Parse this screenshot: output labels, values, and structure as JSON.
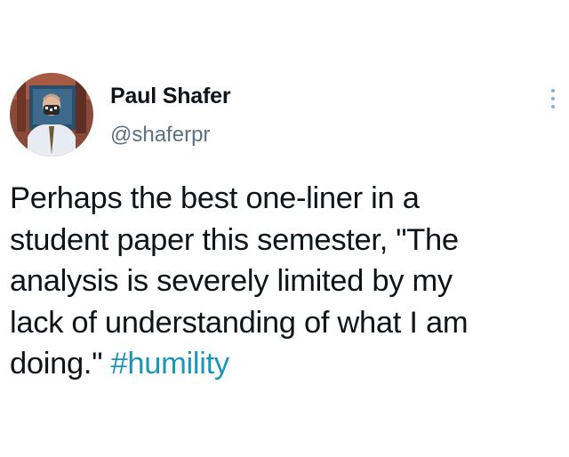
{
  "author": {
    "display_name": "Paul Shafer",
    "handle": "@shaferpr",
    "avatar_icon": "profile-photo-masked-man"
  },
  "more_menu_icon": "vertical-ellipsis-icon",
  "tweet": {
    "lines": [
      "Perhaps the best one-liner in a",
      "student paper this semester, \"The",
      "analysis is severely limited by my",
      "lack of understanding of what I am"
    ],
    "last_line_text": "doing.\" ",
    "hashtag": "#humility"
  },
  "colors": {
    "text": "#0f1419",
    "handle": "#5b7083",
    "hashtag": "#1b95b8",
    "more_dots": "#8bb0c8"
  }
}
